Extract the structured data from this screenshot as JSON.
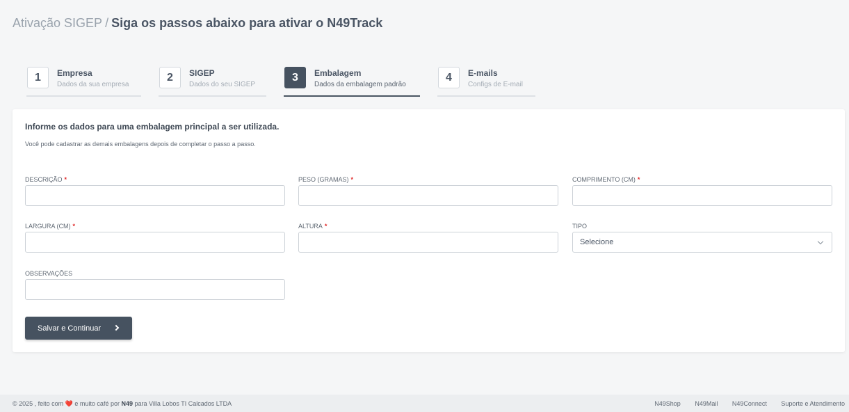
{
  "header": {
    "crumb": "Ativação SIGEP",
    "separator": "/",
    "title": "Siga os passos abaixo para ativar o N49Track"
  },
  "steps": [
    {
      "number": "1",
      "title": "Empresa",
      "subtitle": "Dados da sua empresa"
    },
    {
      "number": "2",
      "title": "SIGEP",
      "subtitle": "Dados do seu SIGEP"
    },
    {
      "number": "3",
      "title": "Embalagem",
      "subtitle": "Dados da embalagem padrão"
    },
    {
      "number": "4",
      "title": "E-mails",
      "subtitle": "Configs de E-mail"
    }
  ],
  "form": {
    "heading": "Informe os dados para uma embalagem principal a ser utilizada.",
    "subheading": "Você pode cadastrar as demais embalagens depois de completar o passo a passo.",
    "fields": {
      "descricao": {
        "label": "DESCRIÇÃO",
        "required_mark": "*",
        "value": ""
      },
      "peso": {
        "label": "PESO (GRAMAS)",
        "required_mark": "*",
        "value": ""
      },
      "comprimento": {
        "label": "COMPRIMENTO (CM)",
        "required_mark": "*",
        "value": ""
      },
      "largura": {
        "label": "LARGURA (CM)",
        "required_mark": "*",
        "value": ""
      },
      "altura": {
        "label": "ALTURA",
        "required_mark": "*",
        "value": ""
      },
      "tipo": {
        "label": "TIPO",
        "selected": "Selecione"
      },
      "observacoes": {
        "label": "OBSERVAÇÕES",
        "value": ""
      }
    },
    "submit_label": "Salvar e Continuar"
  },
  "footer": {
    "prefix": "© 2025 , feito com",
    "heart": "❤️",
    "middle": "e muito café por",
    "brand": "N49",
    "suffix": "para Villa Lobos TI Calcados LTDA",
    "links": [
      "N49Shop",
      "N49Mail",
      "N49Connect",
      "Suporte e Atendimento"
    ]
  },
  "colors": {
    "accent": "#465260",
    "required": "#e02b2b",
    "background": "#f5f6f7"
  }
}
